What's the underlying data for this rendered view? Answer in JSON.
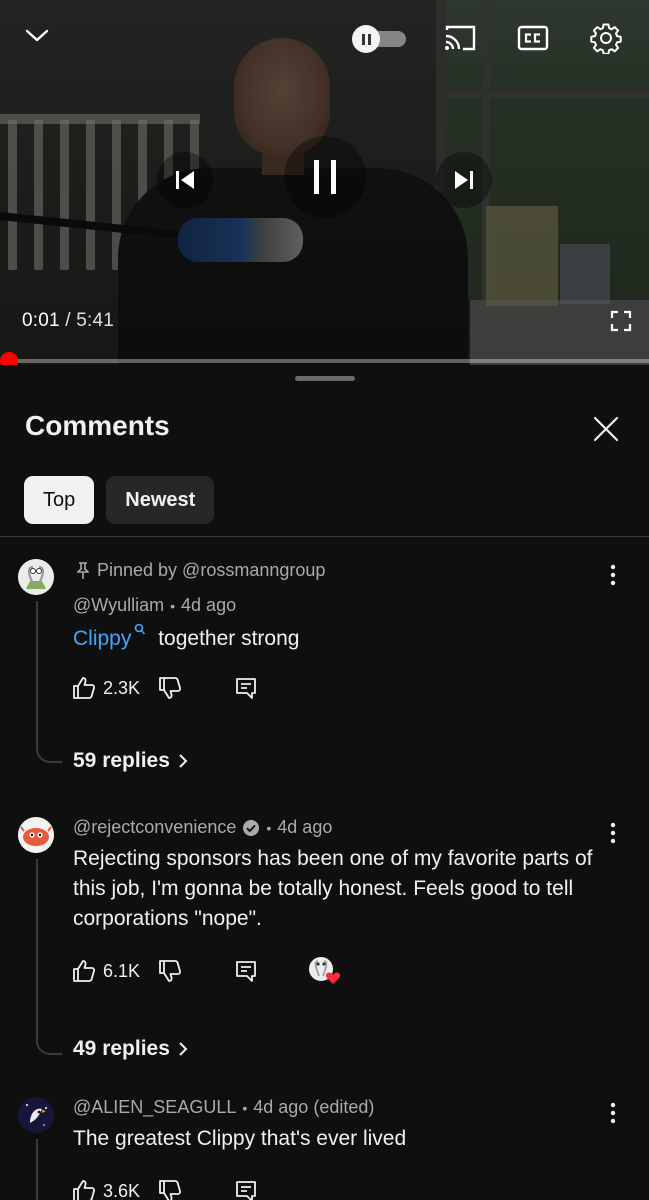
{
  "player": {
    "current_time": "0:01",
    "separator": "/",
    "duration": "5:41",
    "progress_fraction": 0.006,
    "accent_color": "#ff0000"
  },
  "comments_panel": {
    "title": "Comments",
    "tabs": [
      {
        "label": "Top",
        "selected": true
      },
      {
        "label": "Newest",
        "selected": false
      }
    ]
  },
  "comments": [
    {
      "pinned_label": "Pinned by @rossmanngroup",
      "author": "@Wyulliam",
      "age": "4d ago",
      "mention": "Clippy",
      "text": "together strong",
      "likes": "2.3K",
      "replies": "59 replies"
    },
    {
      "author": "@rejectconvenience",
      "verified": true,
      "age": "4d ago",
      "text": "Rejecting sponsors has been one of my favorite parts of this job, I'm gonna be totally honest. Feels good to tell corporations \"nope\".",
      "likes": "6.1K",
      "creator_hearted": true,
      "replies": "49 replies"
    },
    {
      "author": "@ALIEN_SEAGULL",
      "age": "4d ago (edited)",
      "text": "The greatest Clippy that's ever lived",
      "likes": "3.6K"
    }
  ]
}
